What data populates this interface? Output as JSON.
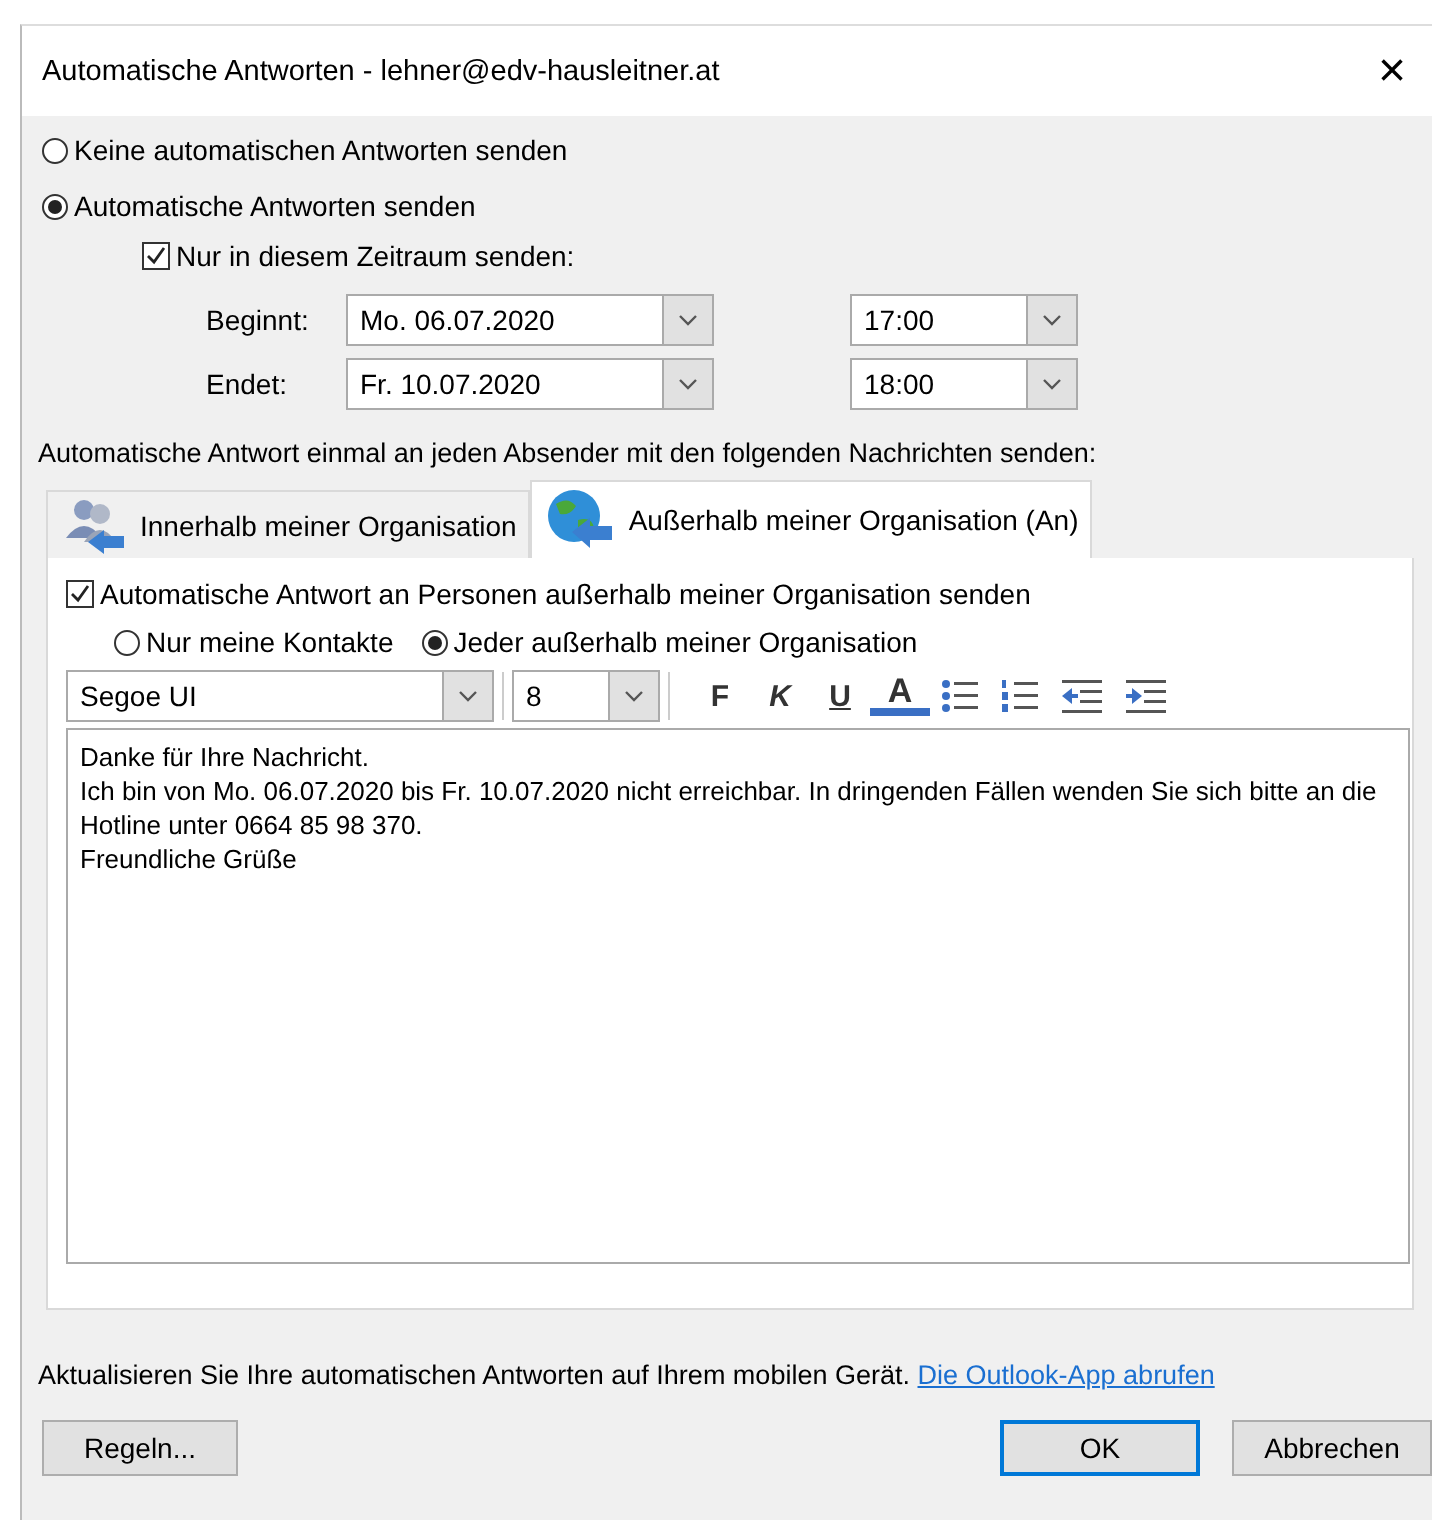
{
  "window": {
    "title": "Automatische Antworten - lehner@edv-hausleitner.at",
    "close": "×"
  },
  "reply_mode": [
    {
      "label": "Keine automatischen Antworten senden",
      "selected": false
    },
    {
      "label": "Automatische Antworten senden",
      "selected": true
    }
  ],
  "time_range": {
    "label": "Nur in diesem Zeitraum senden:",
    "checked": true
  },
  "schedule": [
    {
      "label": "Beginnt:",
      "date": "Mo. 06.07.2020",
      "time": "17:00"
    },
    {
      "label": "Endet:",
      "date": "Fr. 10.07.2020",
      "time": "18:00"
    }
  ],
  "tabs_intro": "Automatische Antwort einmal an jeden Absender mit den folgenden Nachrichten senden:",
  "tabs": [
    {
      "label": "Innerhalb meiner Organisation",
      "kind": "people",
      "selected": false
    },
    {
      "label": "Außerhalb meiner Organisation (An)",
      "kind": "globe",
      "selected": true
    }
  ],
  "outside": {
    "label": "Automatische Antwort an Personen außerhalb meiner Organisation senden",
    "checked": true
  },
  "audience": [
    {
      "label": "Nur meine Kontakte",
      "selected": false
    },
    {
      "label": "Jeder außerhalb meiner Organisation",
      "selected": true
    }
  ],
  "font": {
    "name": "Segoe UI",
    "size": "8"
  },
  "toolbar": [
    {
      "kind": "bold",
      "label": "F"
    },
    {
      "kind": "italic",
      "label": "K"
    },
    {
      "kind": "underline",
      "label": "U"
    },
    {
      "kind": "fontcolor",
      "label": "A"
    },
    {
      "kind": "bullets"
    },
    {
      "kind": "numbering"
    },
    {
      "kind": "outdent"
    },
    {
      "kind": "indent"
    }
  ],
  "message": [
    "Danke für Ihre Nachricht.",
    "Ich bin von Mo. 06.07.2020 bis Fr. 10.07.2020 nicht erreichbar. In dringenden Fällen wenden Sie sich bitte an die Hotline unter 0664 85 98 370.",
    "Freundliche Grüße"
  ],
  "mobile_note": {
    "text": "Aktualisieren Sie Ihre automatischen Antworten auf Ihrem mobilen Gerät.",
    "link": "Die Outlook-App abrufen"
  },
  "buttons": [
    {
      "label": "Regeln...",
      "kind": "rules"
    },
    {
      "label": "OK",
      "kind": "default"
    },
    {
      "label": "Abbrechen",
      "kind": "cancel"
    }
  ]
}
